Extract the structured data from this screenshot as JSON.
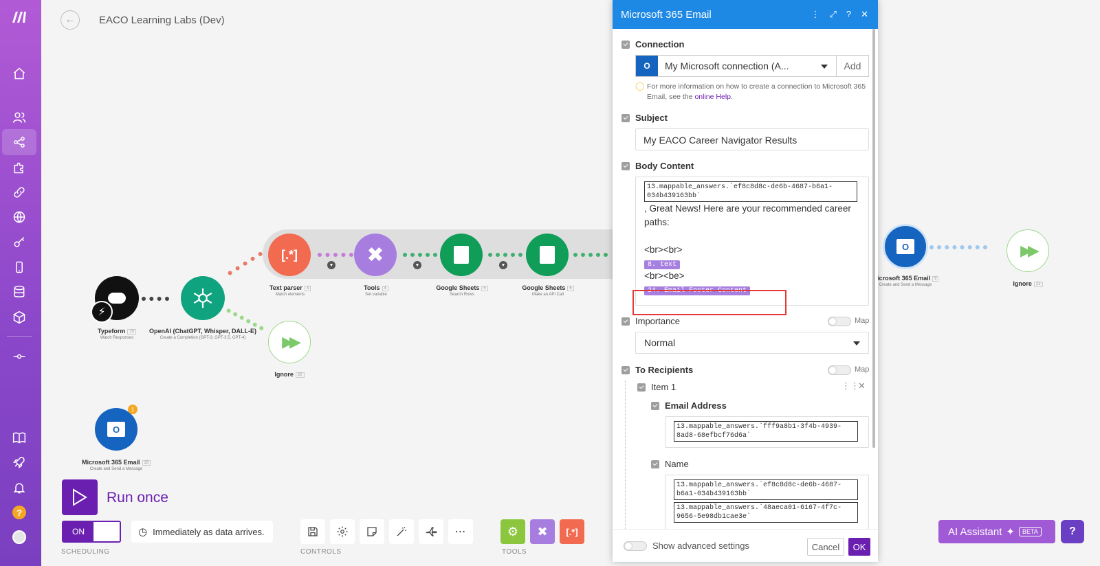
{
  "header": {
    "title": "EACO Learning Labs (Dev)"
  },
  "nodes": {
    "typeform": {
      "label": "Typeform",
      "badge": "10",
      "sub": "Watch Responses"
    },
    "openai": {
      "label": "OpenAI (ChatGPT, Whisper, DALL-E)",
      "badge": "3",
      "sub": "Create a Completion (GPT-3, GPT-3.5, GPT-4)"
    },
    "ignore1": {
      "label": "Ignore",
      "badge": "20"
    },
    "text_parser": {
      "label": "Text parser",
      "badge": "3",
      "sub": "Match elements"
    },
    "tools": {
      "label": "Tools",
      "badge": "4",
      "sub": "Set variable"
    },
    "gsheets1": {
      "label": "Google Sheets",
      "badge": "5",
      "sub": "Search Rows"
    },
    "gsheets2": {
      "label": "Google Sheets",
      "badge": "6",
      "sub": "Make an API Call"
    },
    "ms365_right": {
      "label": "Microsoft 365 Email",
      "badge": "9",
      "sub": "Create and Send a Message"
    },
    "ignore2": {
      "label": "Ignore",
      "badge": "22"
    },
    "ms365_bottom": {
      "label": "Microsoft 365 Email",
      "badge": "28",
      "sub": "Create and Send a Message",
      "notif": "1"
    }
  },
  "bottom": {
    "run_label": "Run once",
    "toggle_label": "ON",
    "schedule_text": "Immediately as data arrives.",
    "scheduling_label": "SCHEDULING",
    "controls_label": "CONTROLS",
    "tools_label": "TOOLS",
    "ai_label": "AI Assistant",
    "beta": "BETA"
  },
  "panel": {
    "title": "Microsoft 365 Email",
    "connection_label": "Connection",
    "connection_value": "My Microsoft connection (A...",
    "add_label": "Add",
    "hint_text": "For more information on how to create a connection to Microsoft 365 Email, see the ",
    "hint_link": "online Help",
    "hint_end": ".",
    "subject_label": "Subject",
    "subject_value": "My EACO Career Navigator Results",
    "body_label": "Body Content",
    "body_pill": "13.mappable_answers.`ef8c8d8c-de6b-4687-b6a1-034b439163bb`",
    "body_line1": ", Great News! Here are your recommended career paths:",
    "body_br1": "<br><br>",
    "body_tag1": "8. text",
    "body_br2": "<br><be>",
    "body_tag2": "24. Email Footer Content",
    "importance_label": "Importance",
    "importance_value": "Normal",
    "map_label": "Map",
    "recipients_label": "To Recipients",
    "item_label": "Item 1",
    "email_label": "Email Address",
    "email_pill": "13.mappable_answers.`fff9a8b1-3f4b-4939-8ad8-68efbcf76d6a`",
    "name_label": "Name",
    "name_pill1": "13.mappable_answers.`ef8c8d8c-de6b-4687-b6a1-034b439163bb`",
    "name_pill2": "13.mappable_answers.`48aeca01-6167-4f7c-9656-5e98db1cae3e`",
    "advanced_label": "Show advanced settings",
    "cancel_label": "Cancel",
    "ok_label": "OK"
  },
  "colors": {
    "accent": "#6b1fb1",
    "panel_header": "#1e88e5",
    "highlight": "#e53935"
  }
}
